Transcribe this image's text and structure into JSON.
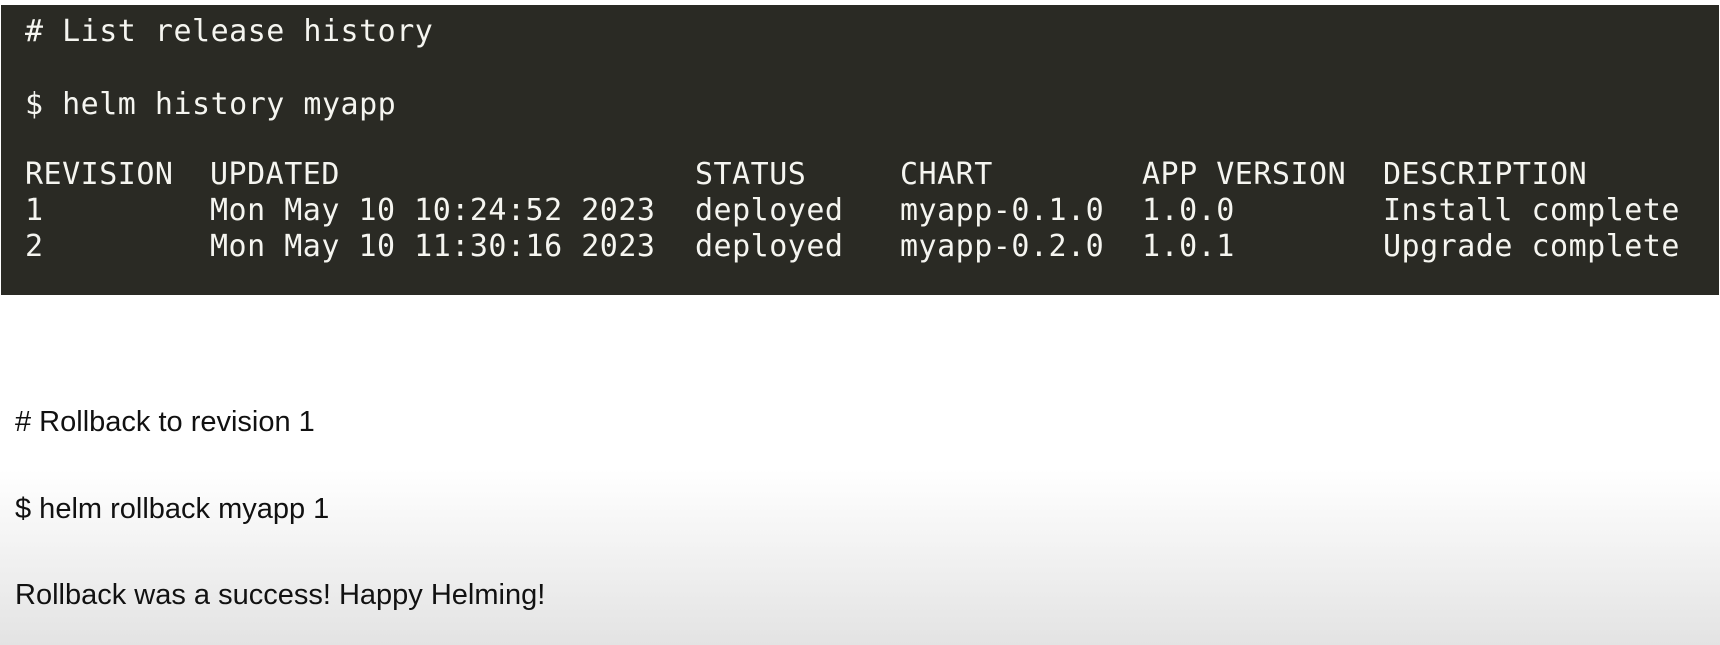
{
  "terminal": {
    "comment": "# List release history",
    "command": "$ helm history myapp",
    "columns": [
      "REVISION",
      "UPDATED",
      "STATUS",
      "CHART",
      "APP VERSION",
      "DESCRIPTION"
    ],
    "rows": [
      [
        "1",
        "Mon May 10 10:24:52 2023",
        "deployed",
        "myapp-0.1.0",
        "1.0.0",
        "Install complete"
      ],
      [
        "2",
        "Mon May 10 11:30:16 2023",
        "deployed",
        "myapp-0.2.0",
        "1.0.1",
        "Upgrade complete"
      ]
    ],
    "background_color": "#2a2a24",
    "text_color": "#f5f5f0"
  },
  "notes": {
    "comment": "# Rollback to revision 1",
    "command": "$ helm rollback myapp 1",
    "output": "Rollback was a success! Happy Helming!"
  }
}
